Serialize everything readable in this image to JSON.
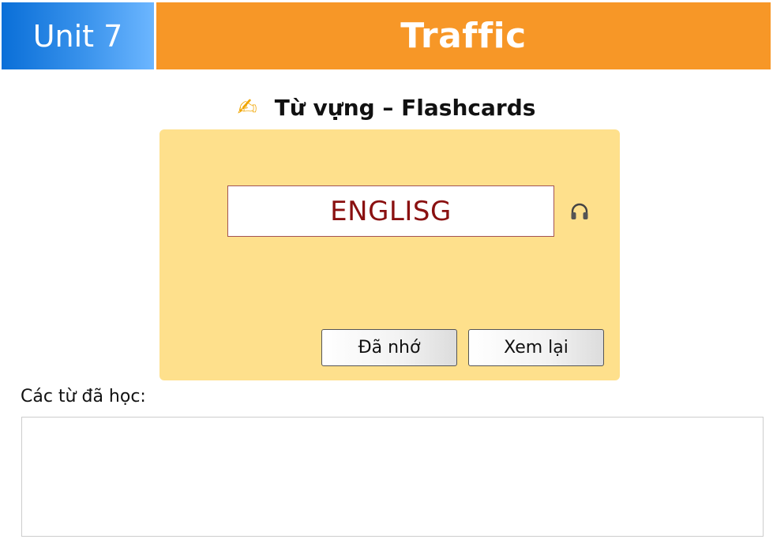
{
  "header": {
    "unit_label": "Unit 7",
    "title": "Traffic",
    "colors": {
      "unit_gradient_start": "#0a6fd8",
      "unit_gradient_end": "#6cb6ff",
      "title_bg": "#f79727"
    }
  },
  "section": {
    "icon": "writing-hand-icon",
    "heading": "Từ vựng – Flashcards"
  },
  "flashcard": {
    "word": "ENGLISG",
    "audio_icon": "headphones-icon",
    "card_color": "#fee08c",
    "word_color": "#8a1010"
  },
  "actions": {
    "remembered_label": "Đã nhớ",
    "review_label": "Xem lại"
  },
  "learned": {
    "label": "Các từ đã học:",
    "items": []
  }
}
